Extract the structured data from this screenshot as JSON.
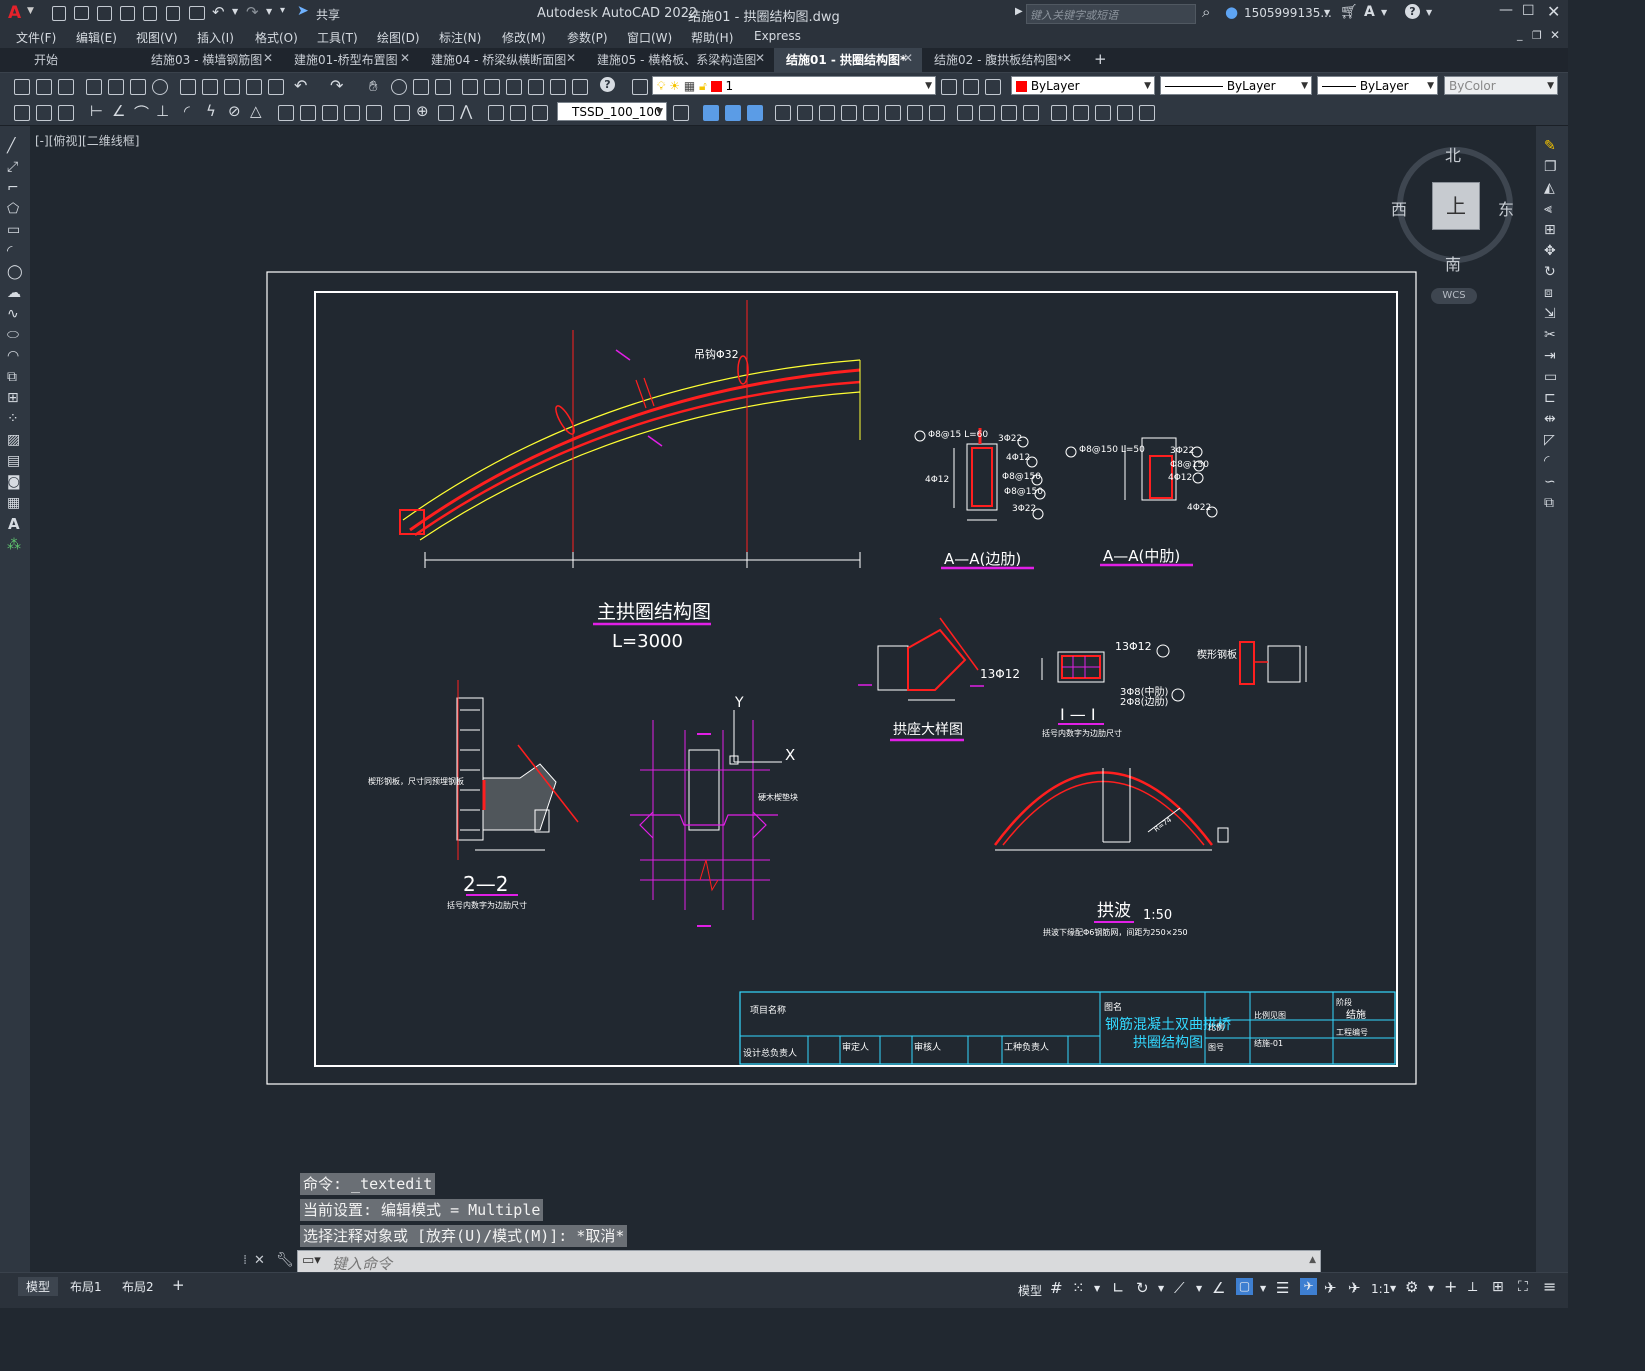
{
  "app": {
    "title": "Autodesk AutoCAD 2022",
    "file": "结施01 - 拱圈结构图.dwg",
    "share": "共享",
    "search_placeholder": "键入关键字或短语",
    "user": "1505999135...",
    "logo": "A"
  },
  "menu": [
    "文件(F)",
    "编辑(E)",
    "视图(V)",
    "插入(I)",
    "格式(O)",
    "工具(T)",
    "绘图(D)",
    "标注(N)",
    "修改(M)",
    "参数(P)",
    "窗口(W)",
    "帮助(H)",
    "Express"
  ],
  "tabs": [
    {
      "label": "开始"
    },
    {
      "label": "结施03 - 横墙钢筋图"
    },
    {
      "label": "建施01-桥型布置图"
    },
    {
      "label": "建施04 - 桥梁纵横断面图"
    },
    {
      "label": "建施05 - 横格板、系梁构造图"
    },
    {
      "label": "结施01 - 拱圈结构图*"
    },
    {
      "label": "结施02 - 腹拱板结构图*"
    }
  ],
  "toolbar": {
    "layer_value": "1",
    "color_value": "ByLayer",
    "linetype_value": "ByLayer",
    "lineweight_value": "ByLayer",
    "plotstyle_value": "ByColor",
    "dimstyle_value": "TSSD_100_100"
  },
  "colors": {
    "layer_swatch": "#ff0000",
    "drawing_red": "#ff1f1f",
    "drawing_yellow": "#ffff33",
    "drawing_magenta": "#e11fe6",
    "drawing_cyan": "#33d8ff"
  },
  "viewport": {
    "label": "[-][俯视][二维线框]"
  },
  "viewcube": {
    "north": "北",
    "south": "南",
    "east": "东",
    "west": "西",
    "top": "上",
    "wcs": "WCS"
  },
  "drawing": {
    "main_title": "主拱圈结构图",
    "main_length": "L=3000",
    "rebar_label": "吊钩Φ32",
    "section_aa_edge": "A—A(边肋)",
    "section_aa_mid": "A—A(中肋)",
    "aa_edge_notes": [
      "Φ8@15 L=60",
      "3Φ22",
      "4Φ12",
      "Φ8@150",
      "Φ8@150",
      "3Φ22",
      "4Φ12"
    ],
    "aa_mid_notes": [
      "Φ8@150 L=50",
      "3Φ22",
      "Φ8@150",
      "4Φ12",
      "4Φ22"
    ],
    "arch_seat_title": "拱座大样图",
    "arch_seat_note": "13Φ12",
    "section_ii_title": "I — I",
    "section_ii_note_top": "13Φ12",
    "section_ii_note_mid": "3Φ8(中肋)",
    "section_ii_note_low": "2Φ8(边肋)",
    "section_ii_caption": "括号内数字为边肋尺寸",
    "wedge_label": "楔形钢板",
    "section_22_title": "2—2",
    "section_22_caption": "括号内数字为边肋尺寸",
    "section_22_note": "楔形钢板，尺寸同预埋钢板",
    "center_note": "硬木楔垫块",
    "ucs_y": "Y",
    "ucs_x": "X",
    "arch_wave_title": "拱波",
    "arch_wave_scale": "1:50",
    "arch_wave_caption": "拱波下缘配Φ6钢筋网，间距为250×250",
    "arch_wave_radius": "R=74"
  },
  "titleblock": {
    "project_label": "项目名称",
    "design_lead": "设计总负责人",
    "reviewer": "审定人",
    "checker": "审核人",
    "engineer": "工种负责人",
    "drawing_name_label": "图名",
    "drawing_name": "钢筋混凝土双曲拱桥拱圈结构图",
    "stage_label": "阶段",
    "stage_value": "结施",
    "scale_label": "比例",
    "scale_value": "比例见图",
    "number_label": "图号",
    "number_value": "结施-01",
    "project_no": "工程编号"
  },
  "command": {
    "history": [
      "命令: _textedit",
      "当前设置: 编辑模式 = Multiple",
      "选择注释对象或 [放弃(U)/模式(M)]: *取消*"
    ],
    "placeholder": "键入命令"
  },
  "status": {
    "layout_tabs": [
      "模型",
      "布局1",
      "布局2"
    ],
    "model": "模型",
    "scale": "1:1"
  }
}
